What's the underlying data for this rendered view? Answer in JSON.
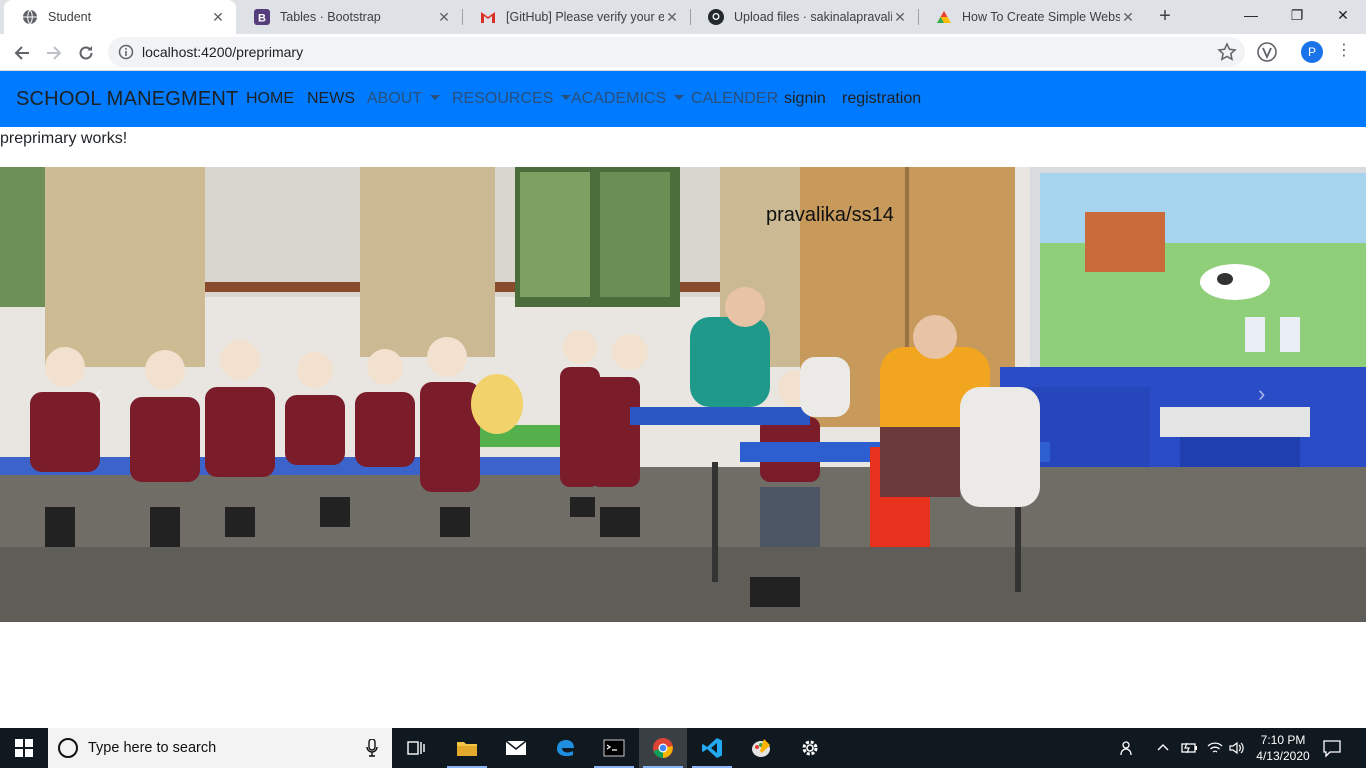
{
  "browser": {
    "tabs": [
      {
        "title": "Student",
        "icon": "globe-icon",
        "active": true
      },
      {
        "title": "Tables · Bootstrap",
        "icon": "bootstrap-icon",
        "active": false
      },
      {
        "title": "[GitHub] Please verify your em",
        "icon": "gmail-icon",
        "active": false
      },
      {
        "title": "Upload files · sakinalapravalika",
        "icon": "github-icon",
        "active": false
      },
      {
        "title": "How To Create Simple Website",
        "icon": "colorful-icon",
        "active": false
      }
    ],
    "url": "localhost:4200/preprimary",
    "profile_initial": "P"
  },
  "site": {
    "brand": "SCHOOL MANEGMENT",
    "nav": {
      "home": "HOME",
      "news": "NEWS",
      "about": "ABOUT",
      "resources": "RESOURCES",
      "academics": "ACADEMICS",
      "calender": "CALENDER",
      "signin": "signin",
      "registration": "registration"
    },
    "page_text": "preprimary works!",
    "carousel_caption": "pravalika/ss14",
    "colors": {
      "navbar": "#007bff"
    }
  },
  "taskbar": {
    "search_placeholder": "Type here to search",
    "time": "7:10 PM",
    "date": "4/13/2020"
  }
}
